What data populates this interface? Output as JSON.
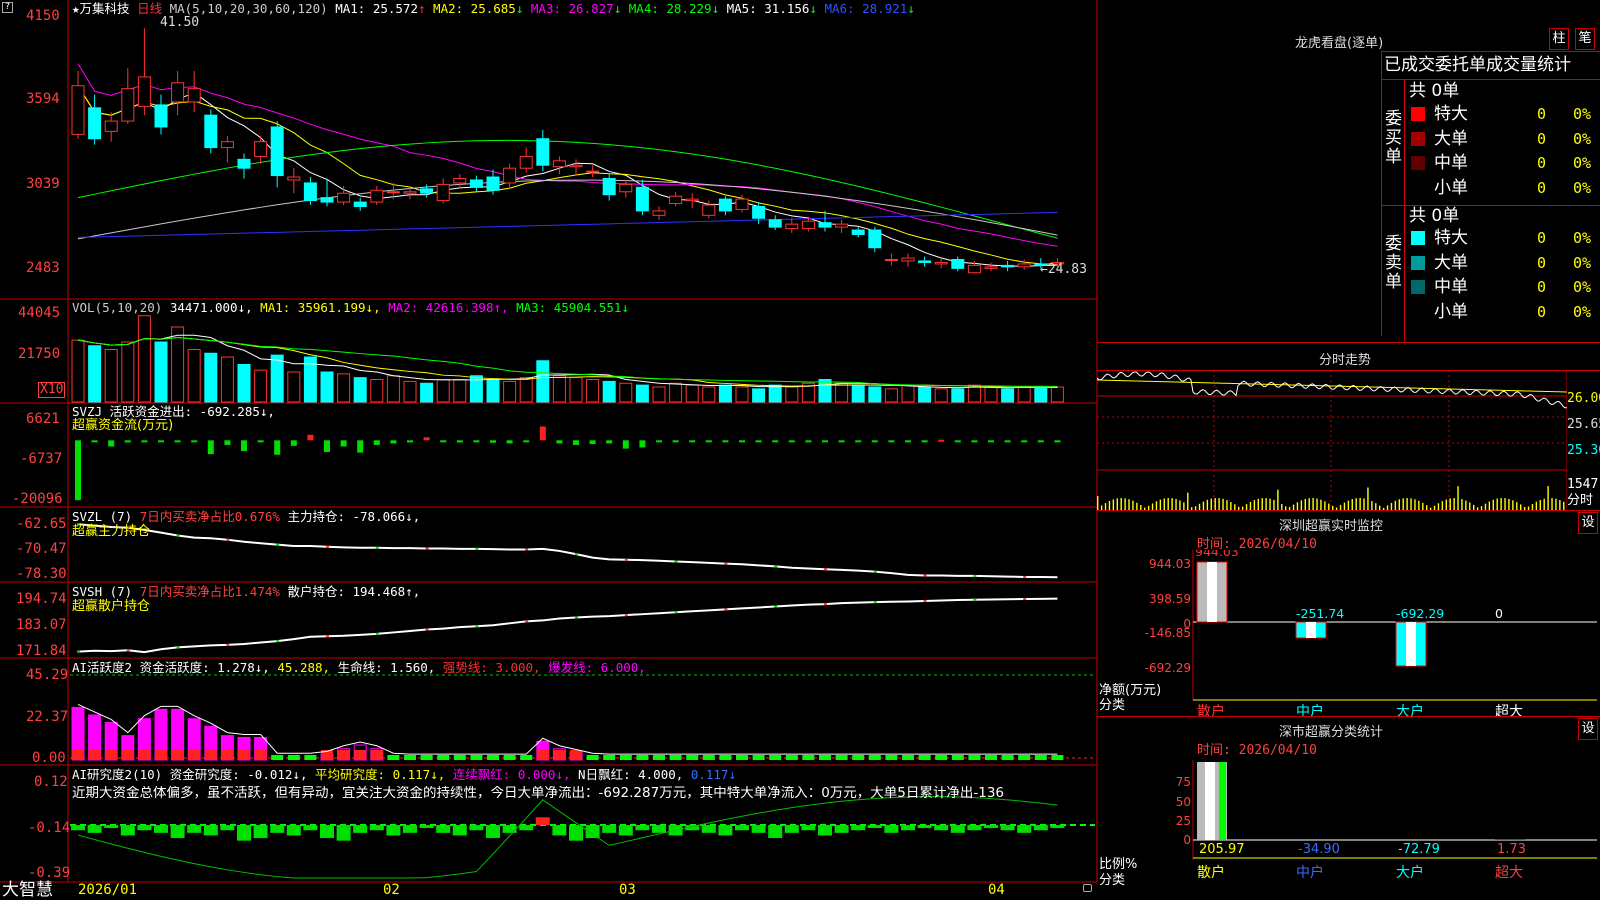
{
  "colors": {
    "up": "#ff3232",
    "down": "#00ffff",
    "ma1": "#ffffff",
    "ma2": "#ffff00",
    "ma3": "#ff00ff",
    "ma4": "#00ff00",
    "ma5": "#c8c8c8",
    "ma6": "#3030ff",
    "grid": "#c00000",
    "axis": "#ff4040"
  },
  "kline": {
    "title": "★万集科技",
    "period": "日线",
    "ma_params": "MA(5,10,20,30,60,120)",
    "ma": [
      {
        "label": "MA1: 25.572",
        "arrow": "↑"
      },
      {
        "label": "MA2: 25.685",
        "arrow": "↓"
      },
      {
        "label": "MA3: 26.827",
        "arrow": "↓"
      },
      {
        "label": "MA4: 28.229",
        "arrow": "↓"
      },
      {
        "label": "MA5: 31.156",
        "arrow": "↓"
      },
      {
        "label": "MA6: 28.921",
        "arrow": "↓"
      }
    ],
    "yticks": [
      "4150",
      "3594",
      "3039",
      "2483"
    ],
    "high_label": "41.50",
    "low_label": "24.83",
    "chart_data": {
      "type": "candlestick",
      "ylim": [
        24.0,
        42.2
      ],
      "candles": [
        {
          "o": 34.3,
          "c": 37.6,
          "h": 38.6,
          "l": 34.0
        },
        {
          "o": 36.1,
          "c": 34.0,
          "h": 37.0,
          "l": 33.6
        },
        {
          "o": 34.5,
          "c": 35.2,
          "h": 35.8,
          "l": 33.8
        },
        {
          "o": 35.2,
          "c": 37.4,
          "h": 38.8,
          "l": 35.0
        },
        {
          "o": 36.2,
          "c": 38.2,
          "h": 41.5,
          "l": 35.6
        },
        {
          "o": 36.3,
          "c": 34.8,
          "h": 37.0,
          "l": 34.3
        },
        {
          "o": 36.5,
          "c": 37.8,
          "h": 38.6,
          "l": 35.6
        },
        {
          "o": 36.5,
          "c": 37.4,
          "h": 38.6,
          "l": 35.8
        },
        {
          "o": 35.6,
          "c": 33.4,
          "h": 36.0,
          "l": 33.0
        },
        {
          "o": 33.4,
          "c": 33.8,
          "h": 34.2,
          "l": 32.4
        },
        {
          "o": 32.6,
          "c": 32.0,
          "h": 33.0,
          "l": 31.3
        },
        {
          "o": 32.8,
          "c": 33.8,
          "h": 34.2,
          "l": 32.3
        },
        {
          "o": 34.8,
          "c": 31.5,
          "h": 35.2,
          "l": 30.7
        },
        {
          "o": 31.2,
          "c": 31.4,
          "h": 32.0,
          "l": 30.3
        },
        {
          "o": 31.0,
          "c": 29.8,
          "h": 31.4,
          "l": 29.5
        },
        {
          "o": 30.0,
          "c": 29.7,
          "h": 31.3,
          "l": 29.4
        },
        {
          "o": 29.7,
          "c": 30.3,
          "h": 30.8,
          "l": 29.5
        },
        {
          "o": 29.7,
          "c": 29.4,
          "h": 30.0,
          "l": 29.1
        },
        {
          "o": 29.7,
          "c": 30.5,
          "h": 30.8,
          "l": 29.5
        },
        {
          "o": 30.4,
          "c": 30.4,
          "h": 31.0,
          "l": 29.9
        },
        {
          "o": 30.3,
          "c": 30.4,
          "h": 30.7,
          "l": 29.9
        },
        {
          "o": 30.6,
          "c": 30.3,
          "h": 30.9,
          "l": 30.0
        },
        {
          "o": 29.8,
          "c": 30.9,
          "h": 31.3,
          "l": 29.6
        },
        {
          "o": 31.0,
          "c": 31.3,
          "h": 31.6,
          "l": 30.6
        },
        {
          "o": 31.2,
          "c": 30.7,
          "h": 31.5,
          "l": 30.4
        },
        {
          "o": 31.4,
          "c": 30.5,
          "h": 31.9,
          "l": 30.2
        },
        {
          "o": 31.0,
          "c": 32.0,
          "h": 32.3,
          "l": 30.6
        },
        {
          "o": 32.0,
          "c": 32.8,
          "h": 33.4,
          "l": 31.7
        },
        {
          "o": 34.0,
          "c": 32.2,
          "h": 34.6,
          "l": 31.8
        },
        {
          "o": 32.1,
          "c": 32.5,
          "h": 32.8,
          "l": 31.6
        },
        {
          "o": 32.1,
          "c": 32.2,
          "h": 32.6,
          "l": 31.5
        },
        {
          "o": 31.8,
          "c": 31.8,
          "h": 32.2,
          "l": 31.4
        },
        {
          "o": 31.3,
          "c": 30.2,
          "h": 31.6,
          "l": 29.8
        },
        {
          "o": 30.4,
          "c": 30.9,
          "h": 31.2,
          "l": 30.0
        },
        {
          "o": 30.7,
          "c": 29.1,
          "h": 31.2,
          "l": 28.8
        },
        {
          "o": 28.8,
          "c": 29.1,
          "h": 29.4,
          "l": 28.5
        },
        {
          "o": 29.6,
          "c": 30.1,
          "h": 30.4,
          "l": 29.4
        },
        {
          "o": 29.8,
          "c": 29.9,
          "h": 30.3,
          "l": 29.3
        },
        {
          "o": 28.8,
          "c": 29.5,
          "h": 29.8,
          "l": 28.6
        },
        {
          "o": 29.9,
          "c": 29.1,
          "h": 30.1,
          "l": 28.8
        },
        {
          "o": 29.2,
          "c": 29.9,
          "h": 30.2,
          "l": 29.0
        },
        {
          "o": 29.4,
          "c": 28.6,
          "h": 29.7,
          "l": 28.2
        },
        {
          "o": 28.5,
          "c": 28.0,
          "h": 28.8,
          "l": 27.8
        },
        {
          "o": 27.9,
          "c": 28.2,
          "h": 28.6,
          "l": 27.6
        },
        {
          "o": 27.9,
          "c": 28.4,
          "h": 28.7,
          "l": 27.7
        },
        {
          "o": 28.3,
          "c": 28.0,
          "h": 29.1,
          "l": 27.7
        },
        {
          "o": 28.0,
          "c": 28.2,
          "h": 28.5,
          "l": 27.6
        },
        {
          "o": 27.8,
          "c": 27.5,
          "h": 28.0,
          "l": 27.3
        },
        {
          "o": 27.8,
          "c": 26.6,
          "h": 28.0,
          "l": 26.3
        },
        {
          "o": 25.8,
          "c": 25.8,
          "h": 26.2,
          "l": 25.4
        },
        {
          "o": 25.7,
          "c": 25.9,
          "h": 26.2,
          "l": 25.3
        },
        {
          "o": 25.7,
          "c": 25.6,
          "h": 26.0,
          "l": 25.3
        },
        {
          "o": 25.5,
          "c": 25.6,
          "h": 25.9,
          "l": 25.2
        },
        {
          "o": 25.8,
          "c": 25.2,
          "h": 26.0,
          "l": 25.0
        },
        {
          "o": 24.9,
          "c": 25.4,
          "h": 25.7,
          "l": 24.83
        },
        {
          "o": 25.2,
          "c": 25.3,
          "h": 25.6,
          "l": 25.0
        },
        {
          "o": 25.4,
          "c": 25.3,
          "h": 25.7,
          "l": 25.0
        },
        {
          "o": 25.3,
          "c": 25.5,
          "h": 25.8,
          "l": 25.1
        },
        {
          "o": 25.5,
          "c": 25.4,
          "h": 25.9,
          "l": 25.2
        },
        {
          "o": 25.5,
          "c": 25.6,
          "h": 25.9,
          "l": 25.3
        }
      ]
    }
  },
  "volume": {
    "title": "VOL(5,10,20)",
    "value": "34471.000↓",
    "ma": [
      {
        "label": "MA1: 35961.199↓"
      },
      {
        "label": "MA2: 42616.398↑"
      },
      {
        "label": "MA3: 45904.551↓"
      }
    ],
    "yticks": [
      "44045",
      "21750"
    ],
    "unit": "X10",
    "chart_data": {
      "type": "bar",
      "max": 48000,
      "values": [
        33000,
        30000,
        28000,
        32000,
        46000,
        32000,
        40000,
        28000,
        26000,
        24000,
        20000,
        17000,
        25000,
        16000,
        24000,
        16000,
        15000,
        13000,
        12000,
        14000,
        11000,
        10000,
        12000,
        12000,
        14000,
        12000,
        11000,
        13000,
        22000,
        14000,
        13000,
        12000,
        11000,
        10000,
        9000,
        8000,
        10000,
        9000,
        8000,
        9000,
        8000,
        7000,
        9000,
        8000,
        10000,
        12000,
        10000,
        9000,
        8000,
        7000,
        9000,
        8000,
        7000,
        7000,
        9000,
        8000,
        7000,
        8000,
        7500,
        8000
      ]
    }
  },
  "svzj": {
    "title": "SVZJ  活跃资金进出: -692.285↓,",
    "subtitle": "超赢资金流(万元)",
    "yticks": [
      "6621",
      "-6737",
      "-20096"
    ],
    "chart_data": {
      "type": "bar",
      "ylim": [
        -20096,
        6621
      ],
      "values": [
        -19500,
        -300,
        -2000,
        -700,
        -300,
        -400,
        -300,
        -200,
        -4500,
        -1500,
        -3500,
        -200,
        -4700,
        -1800,
        1800,
        -3800,
        -2000,
        -4000,
        -1500,
        -1000,
        -700,
        1000,
        -500,
        -700,
        -300,
        -800,
        -1000,
        -300,
        4500,
        -1000,
        -1500,
        -1200,
        -1000,
        -2700,
        -2300,
        -400,
        -500,
        -300,
        -200,
        -100,
        -300,
        -150,
        -200,
        -300,
        -120,
        -100,
        -400,
        -100,
        -300,
        -200,
        -150,
        -120,
        200,
        -150,
        -100,
        -200,
        -150,
        -120,
        -100,
        -150
      ]
    }
  },
  "svzl": {
    "title": "SVZL (7) ",
    "seg1": "7日内买卖净占比0.676%",
    "seg2": "主力持仓: -78.066↓,",
    "subtitle": "超赢主力持仓",
    "yticks": [
      "-62.65",
      "-70.47",
      "-78.30"
    ],
    "chart_data": {
      "type": "line",
      "ylim": [
        -78.3,
        -62.65
      ],
      "values": [
        -63.0,
        -63.4,
        -63.8,
        -64.0,
        -64.6,
        -65.4,
        -66.2,
        -66.8,
        -67.0,
        -67.4,
        -68.0,
        -68.4,
        -68.8,
        -69.2,
        -69.2,
        -69.4,
        -69.6,
        -69.7,
        -69.7,
        -69.8,
        -69.8,
        -69.9,
        -69.9,
        -70.0,
        -70.0,
        -70.1,
        -70.2,
        -70.2,
        -70.0,
        -70.6,
        -71.5,
        -72.5,
        -73.0,
        -73.1,
        -73.2,
        -73.4,
        -73.6,
        -73.8,
        -74.0,
        -74.2,
        -74.4,
        -74.7,
        -75.0,
        -75.4,
        -75.6,
        -75.8,
        -76.0,
        -76.2,
        -76.5,
        -76.9,
        -77.4,
        -77.6,
        -77.6,
        -77.7,
        -77.7,
        -77.8,
        -77.9,
        -78.0,
        -78.0,
        -78.07
      ]
    }
  },
  "svsh": {
    "title": "SVSH (7) ",
    "seg1": "7日内买卖净占比1.474%",
    "seg2": "散户持仓: 194.468↑,",
    "subtitle": "超赢散户持仓",
    "yticks": [
      "194.74",
      "183.07",
      "171.84"
    ],
    "chart_data": {
      "type": "line",
      "ylim": [
        171.84,
        194.74
      ],
      "values": [
        172.4,
        172.8,
        172.6,
        173.0,
        172.2,
        173.4,
        174.2,
        174.6,
        175.0,
        175.2,
        175.6,
        176.2,
        176.8,
        177.6,
        178.6,
        178.8,
        179.0,
        179.4,
        179.8,
        180.4,
        181.0,
        181.6,
        182.0,
        182.6,
        183.0,
        183.4,
        184.2,
        185.0,
        185.4,
        186.2,
        186.6,
        187.0,
        187.2,
        187.6,
        188.0,
        188.4,
        188.8,
        189.2,
        189.6,
        190.0,
        190.4,
        190.8,
        191.2,
        191.6,
        192.0,
        192.2,
        192.6,
        192.8,
        193.0,
        193.2,
        193.3,
        193.5,
        193.7,
        193.9,
        194.0,
        194.1,
        194.2,
        194.3,
        194.4,
        194.47
      ]
    }
  },
  "ai1": {
    "title": "AI活跃度2 资金活跃度: 1.278↓,",
    "seg1": "45.288,",
    "seg2": "生命线: 1.560,",
    "seg3": "强势线: 3.000,",
    "seg4": "爆发线: 6.000,",
    "yticks": [
      "45.29",
      "22.37",
      "0.00"
    ],
    "chart_data": {
      "type": "bar",
      "ylim": [
        0,
        45.29
      ],
      "values": [
        28,
        24,
        20,
        13,
        22,
        27,
        27,
        22,
        18,
        13,
        12,
        12,
        2,
        2,
        2,
        3,
        6,
        8,
        6,
        2,
        1.5,
        1.5,
        1.5,
        1.5,
        1.5,
        1.5,
        1.5,
        1.5,
        10,
        6,
        4,
        2,
        1.5,
        1.5,
        1.5,
        1.5,
        1.5,
        1.5,
        1.5,
        1.5,
        1.5,
        1.5,
        1.5,
        1.5,
        1.5,
        1.5,
        1.5,
        1.5,
        1.5,
        1.5,
        1.5,
        1.5,
        1.5,
        1.5,
        1.5,
        1.5,
        1.5,
        1.5,
        1.5,
        1.5
      ]
    }
  },
  "ai2": {
    "title": "AI研究度2(10)",
    "seg1": "资金研究度: -0.012↓,",
    "seg2": "平均研究度: 0.117↓,",
    "seg3": "连续飘红: 0.000↓,",
    "seg4": "N日飘红: 4.000,",
    "seg5": "0.117↓",
    "comment": "近期大资金总体偏多，虽不活跃，但有异动，宜关注大资金的持续性，今日大单净流出：-692.287万元，其中特大单净流入：0万元，大单5日累计净出-136",
    "yticks": [
      "0.12",
      "-0.14",
      "-0.39"
    ],
    "chart_data": {
      "type": "bar",
      "ylim": [
        -0.39,
        0.12
      ],
      "values": [
        -0.02,
        -0.03,
        -0.01,
        -0.04,
        -0.02,
        -0.03,
        -0.05,
        -0.03,
        -0.04,
        -0.02,
        -0.06,
        -0.05,
        -0.03,
        -0.04,
        -0.02,
        -0.05,
        -0.06,
        -0.03,
        -0.02,
        -0.04,
        -0.03,
        -0.01,
        -0.03,
        -0.04,
        -0.02,
        -0.05,
        -0.03,
        -0.02,
        0.03,
        -0.04,
        -0.06,
        -0.05,
        -0.03,
        -0.04,
        -0.02,
        -0.03,
        -0.04,
        -0.02,
        -0.03,
        -0.04,
        -0.02,
        -0.03,
        -0.05,
        -0.03,
        -0.02,
        -0.04,
        -0.03,
        -0.02,
        -0.01,
        -0.03,
        -0.02,
        -0.01,
        -0.02,
        -0.03,
        -0.02,
        -0.01,
        -0.02,
        -0.03,
        -0.02,
        -0.01
      ]
    }
  },
  "date_axis": {
    "labels": [
      "2026/01",
      "02",
      "03",
      "04"
    ]
  },
  "brand": "大智慧",
  "right": {
    "lhb": {
      "title": "龙虎看盘(逐单)",
      "btn1": "柱",
      "btn2": "笔",
      "header": "已成交委托单成交量统计",
      "buy": {
        "label": "委买单",
        "total": "共 0单",
        "rows": [
          {
            "name": "特大",
            "val": "0",
            "pct": "0%",
            "color": "#ff0000"
          },
          {
            "name": "大单",
            "val": "0",
            "pct": "0%",
            "color": "#a00000"
          },
          {
            "name": "中单",
            "val": "0",
            "pct": "0%",
            "color": "#600000"
          },
          {
            "name": "小单",
            "val": "0",
            "pct": "0%",
            "color": "#000000"
          }
        ]
      },
      "sell": {
        "label": "委卖单",
        "total": "共 0单",
        "rows": [
          {
            "name": "特大",
            "val": "0",
            "pct": "0%",
            "color": "#00ffff"
          },
          {
            "name": "大单",
            "val": "0",
            "pct": "0%",
            "color": "#009c9c"
          },
          {
            "name": "中单",
            "val": "0",
            "pct": "0%",
            "color": "#006868"
          },
          {
            "name": "小单",
            "val": "0",
            "pct": "0%",
            "color": "#000000"
          }
        ]
      }
    },
    "fenshi": {
      "title": "分时走势",
      "y1": "26.00",
      "y2": "25.65",
      "y3": "25.30",
      "vol": "1547",
      "vol_label": "分时"
    },
    "monitor": {
      "title": "深圳超赢实时监控",
      "btn": "设",
      "time": "时间: 2026/04/10",
      "yticks": [
        "944.03",
        "398.59",
        "0",
        "-146.85",
        "-692.29"
      ],
      "ylabel": "净额(万元)",
      "xlabel": "分类",
      "bars": [
        {
          "cat": "散户",
          "value": 944.03,
          "label": "944.03",
          "color": "#ffffff"
        },
        {
          "cat": "中户",
          "value": -251.74,
          "label": "-251.74",
          "color": "#00ffff"
        },
        {
          "cat": "大户",
          "value": -692.29,
          "label": "-692.29",
          "color": "#00ffff"
        },
        {
          "cat": "超大",
          "value": 0,
          "label": "0",
          "color": "#ffffff"
        }
      ]
    },
    "classify": {
      "title": "深市超赢分类统计",
      "btn": "设",
      "time": "时间: 2026/04/10",
      "yticks": [
        "75",
        "50",
        "25",
        "0"
      ],
      "ylabel": "比例%",
      "xlabel": "分类",
      "bars": [
        {
          "cat": "散户",
          "value": 205.97,
          "label": "205.97",
          "color": "#ffffff"
        },
        {
          "cat": "中户",
          "value": -34.9,
          "label": "-34.90",
          "color": "#3a6cff"
        },
        {
          "cat": "大户",
          "value": -72.79,
          "label": "-72.79",
          "color": "#00ffff"
        },
        {
          "cat": "超大",
          "value": 1.73,
          "label": "1.73",
          "color": "#ff4040"
        }
      ]
    }
  }
}
